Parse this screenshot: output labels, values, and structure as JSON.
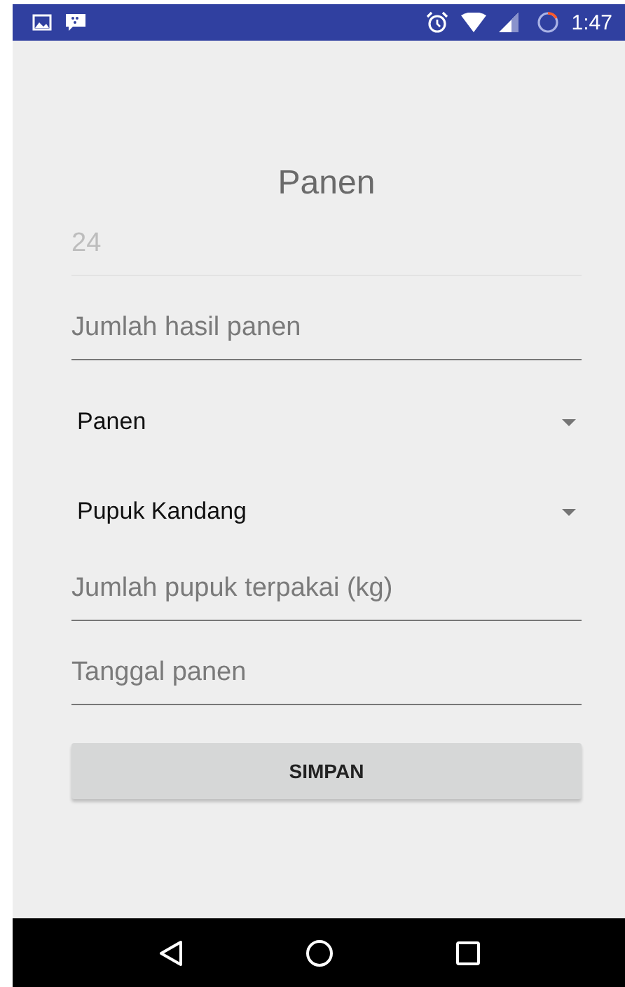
{
  "status_bar": {
    "time": "1:47"
  },
  "title": "Panen",
  "fields": [
    {
      "kind": "text",
      "value": "24",
      "disabled": true
    },
    {
      "kind": "text",
      "placeholder": "Jumlah hasil panen",
      "disabled": false
    },
    {
      "kind": "dropdown",
      "value": "Panen"
    },
    {
      "kind": "dropdown",
      "value": "Pupuk Kandang"
    },
    {
      "kind": "text",
      "placeholder": "Jumlah pupuk terpakai (kg)",
      "disabled": false
    },
    {
      "kind": "text",
      "placeholder": "Tanggal panen",
      "disabled": false
    }
  ],
  "button": {
    "label": "SIMPAN"
  }
}
